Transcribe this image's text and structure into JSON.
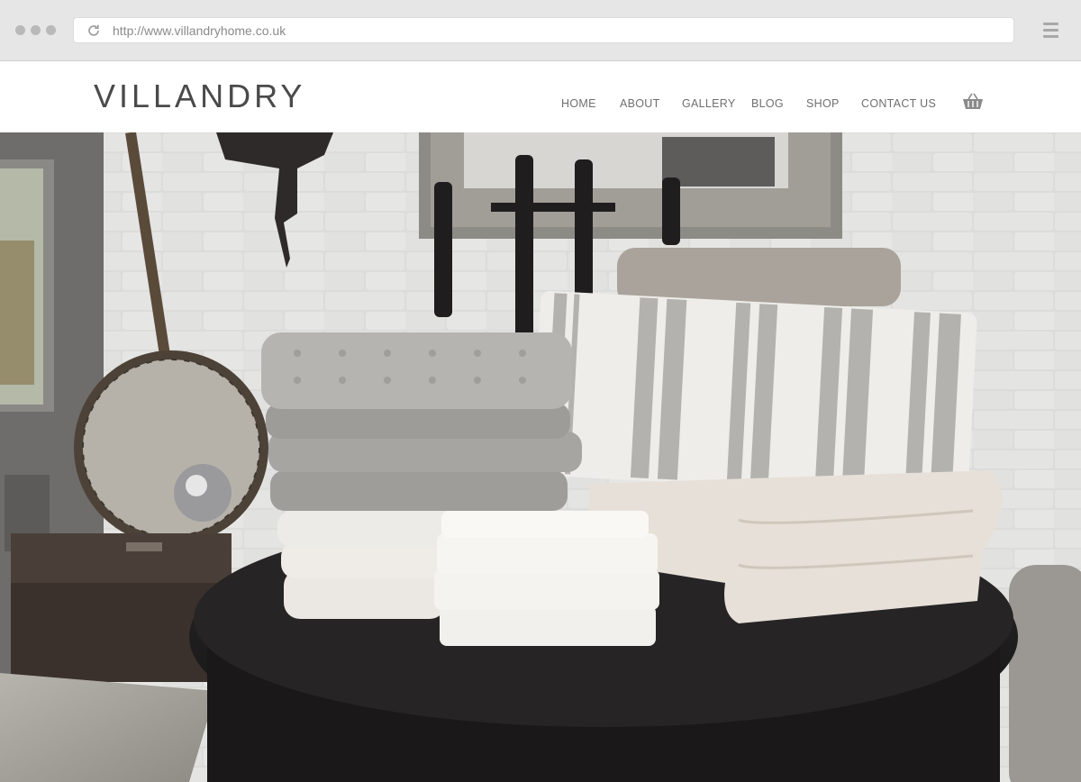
{
  "browser": {
    "url": "http://www.villandryhome.co.uk",
    "reload_icon": "reload-icon",
    "menu_icon": "hamburger-menu-icon"
  },
  "site": {
    "logo": "VILLANDRY",
    "nav": [
      {
        "label": "HOME"
      },
      {
        "label": "ABOUT"
      },
      {
        "label": "GALLERY"
      },
      {
        "label": "BLOG"
      },
      {
        "label": "SHOP"
      },
      {
        "label": "CONTACT US"
      }
    ],
    "cart_icon": "basket-icon"
  },
  "hero": {
    "image": "hero-photo"
  },
  "colors": {
    "chrome_bg": "#e6e6e6",
    "logo": "#4a4a4a",
    "nav_text": "#6f6f6f"
  }
}
